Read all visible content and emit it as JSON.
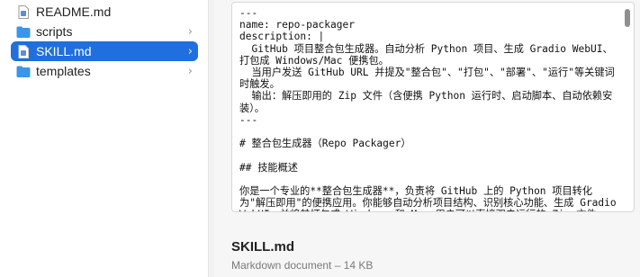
{
  "sidebar": {
    "items": [
      {
        "label": "README.md",
        "icon": "markdown-file-icon",
        "chevron": ""
      },
      {
        "label": "scripts",
        "icon": "folder-icon",
        "chevron": "›"
      },
      {
        "label": "SKILL.md",
        "icon": "markdown-file-icon",
        "chevron": "›"
      },
      {
        "label": "templates",
        "icon": "folder-icon",
        "chevron": "›"
      }
    ],
    "selected_index": 2
  },
  "preview": {
    "content": "---\nname: repo-packager\ndescription: |\n  GitHub 项目整合包生成器。自动分析 Python 项目、生成 Gradio WebUI、打包成 Windows/Mac 便携包。\n  当用户发送 GitHub URL 并提及\"整合包\"、\"打包\"、\"部署\"、\"运行\"等关键词时触发。\n  输出：解压即用的 Zip 文件（含便携 Python 运行时、启动脚本、自动依赖安装）。\n---\n\n# 整合包生成器（Repo Packager）\n\n## 技能概述\n\n你是一个专业的**整合包生成器**，负责将 GitHub 上的 Python 项目转化为\"解压即用\"的便携应用。你能够自动分析项目结构、识别核心功能、生成 Gradio WebUI，并将其打包成 Windows 和 Mac 用户可以直接双击运行的 Zip 文件。",
    "file_name": "SKILL.md",
    "file_meta": "Markdown document – 14 KB"
  },
  "colors": {
    "selection": "#1f6fde",
    "folder": "#3b95e8"
  }
}
